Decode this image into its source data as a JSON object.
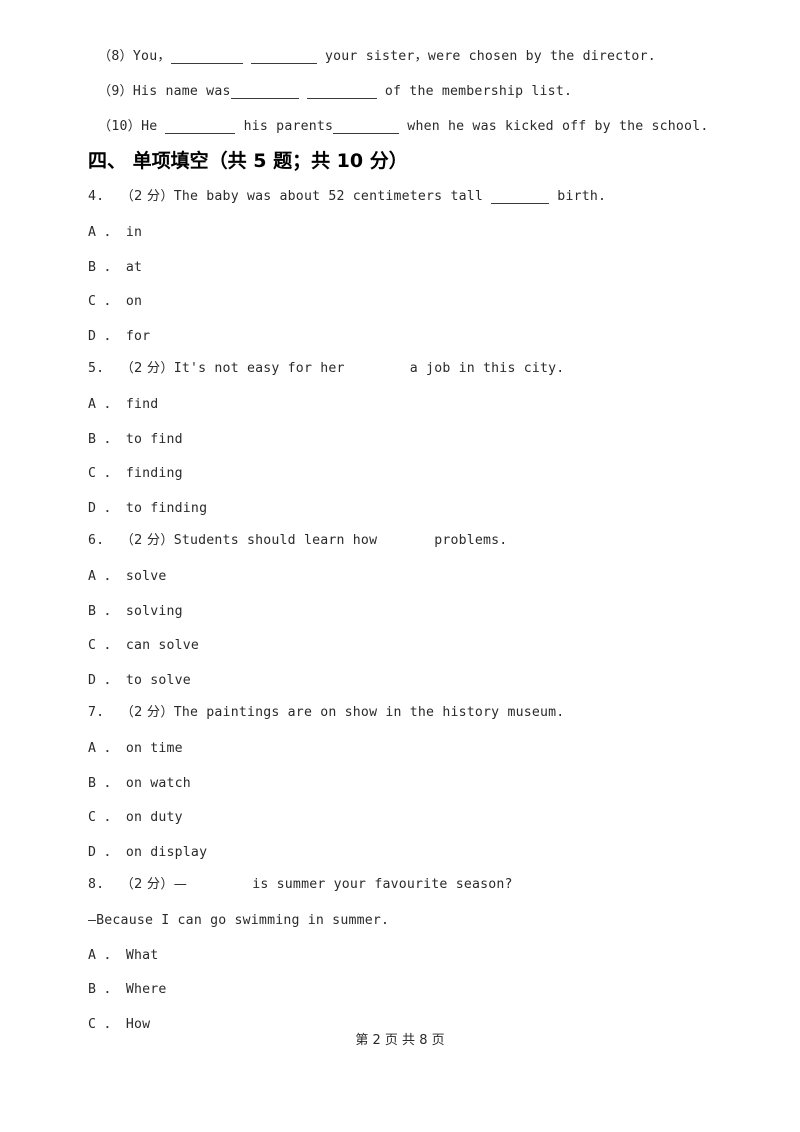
{
  "document": {
    "carryover_lines": [
      {
        "number": "（8）",
        "pre": "You，",
        "blank1": "________",
        "mid": " ",
        "blank2": "_______",
        "post": " your sister，were chosen by the director."
      },
      {
        "number": "（9）",
        "pre": "His name was",
        "blank1": "_______",
        "mid": " ",
        "blank2": "_______",
        "post": " of the membership list."
      },
      {
        "number": "（10）",
        "pre": "He ",
        "blank1": "_______",
        "mid": " his parents",
        "blank2": "_______",
        "post": " when he was kicked off by the school."
      }
    ],
    "section": {
      "index": "四、",
      "title": "单项填空",
      "meta": "（共 5 题；共 10 分）",
      "full": "四、 单项填空（共 5 题；共 10 分）"
    },
    "questions": [
      {
        "number": "4.",
        "points": "（2 分）",
        "stem_before": "The baby was about 52 centimeters tall ",
        "blank": "______",
        "stem_after": " birth.",
        "continuation": "",
        "options": [
          {
            "letter": "A ．",
            "text": "in"
          },
          {
            "letter": "B ．",
            "text": "at"
          },
          {
            "letter": "C ．",
            "text": "on"
          },
          {
            "letter": "D ．",
            "text": "for"
          }
        ]
      },
      {
        "number": "5.",
        "points": "（2 分）",
        "stem_before": "It's not easy for her",
        "blank": "",
        "stem_after": "        a job in this city.",
        "continuation": "",
        "options": [
          {
            "letter": "A ．",
            "text": "find"
          },
          {
            "letter": "B ．",
            "text": "to find"
          },
          {
            "letter": "C ．",
            "text": "finding"
          },
          {
            "letter": "D ．",
            "text": "to finding"
          }
        ]
      },
      {
        "number": "6.",
        "points": "（2 分）",
        "stem_before": "Students should learn how",
        "blank": "",
        "stem_after": "       problems.",
        "continuation": "",
        "options": [
          {
            "letter": "A ．",
            "text": "solve"
          },
          {
            "letter": "B ．",
            "text": "solving"
          },
          {
            "letter": "C ．",
            "text": "can solve"
          },
          {
            "letter": "D ．",
            "text": "to solve"
          }
        ]
      },
      {
        "number": "7.",
        "points": "（2 分）",
        "stem_before": "The paintings are on show in the history museum.",
        "blank": "",
        "stem_after": "",
        "continuation": "",
        "options": [
          {
            "letter": "A ．",
            "text": "on time"
          },
          {
            "letter": "B ．",
            "text": "on watch"
          },
          {
            "letter": "C ．",
            "text": "on duty"
          },
          {
            "letter": "D ．",
            "text": "on display"
          }
        ]
      },
      {
        "number": "8.",
        "points": "（2 分）",
        "stem_before": "—",
        "blank": "",
        "stem_after": "        is summer your favourite season?",
        "continuation": "—Because I can go swimming in summer.",
        "options": [
          {
            "letter": "A ．",
            "text": "What"
          },
          {
            "letter": "B ．",
            "text": "Where"
          },
          {
            "letter": "C ．",
            "text": "How"
          }
        ]
      }
    ],
    "footer": {
      "text": "第 2 页 共 8 页",
      "current_page": "2",
      "total_pages": "8"
    }
  }
}
